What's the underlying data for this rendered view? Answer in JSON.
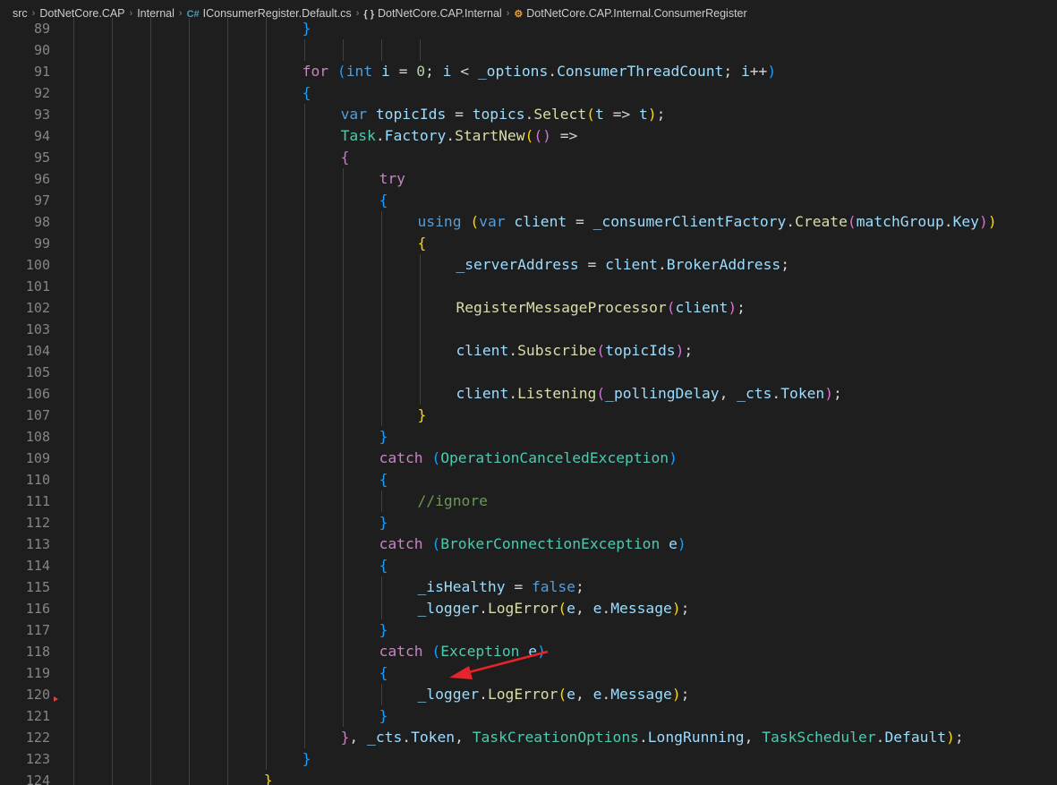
{
  "breadcrumb": {
    "items": [
      {
        "label": "src",
        "icon": ""
      },
      {
        "label": "DotNetCore.CAP",
        "icon": ""
      },
      {
        "label": "Internal",
        "icon": ""
      },
      {
        "label": "IConsumerRegister.Default.cs",
        "icon": "csharp-file-icon"
      },
      {
        "label": "DotNetCore.CAP.Internal",
        "icon": "namespace-icon"
      },
      {
        "label": "DotNetCore.CAP.Internal.ConsumerRegister",
        "icon": "class-icon"
      }
    ],
    "icons": {
      "csharp": "C#",
      "namespace": "{ }",
      "class": "⚙"
    }
  },
  "code": {
    "lines": [
      {
        "n": "89",
        "indent": 6,
        "tokens": [
          {
            "t": "}",
            "c": "b3"
          }
        ]
      },
      {
        "n": "90",
        "indent": 0,
        "tokens": []
      },
      {
        "n": "91",
        "indent": 6,
        "tokens": [
          {
            "t": "for",
            "c": "ctl"
          },
          {
            "t": " "
          },
          {
            "t": "(",
            "c": "b3"
          },
          {
            "t": "int",
            "c": "kw"
          },
          {
            "t": " "
          },
          {
            "t": "i",
            "c": "vr"
          },
          {
            "t": " = "
          },
          {
            "t": "0",
            "c": "num"
          },
          {
            "t": "; "
          },
          {
            "t": "i",
            "c": "vr"
          },
          {
            "t": " < "
          },
          {
            "t": "_options",
            "c": "vr"
          },
          {
            "t": "."
          },
          {
            "t": "ConsumerThreadCount",
            "c": "vr"
          },
          {
            "t": "; "
          },
          {
            "t": "i",
            "c": "vr"
          },
          {
            "t": "++"
          },
          {
            "t": ")",
            "c": "b3"
          }
        ]
      },
      {
        "n": "92",
        "indent": 6,
        "tokens": [
          {
            "t": "{",
            "c": "b3"
          }
        ]
      },
      {
        "n": "93",
        "indent": 7,
        "tokens": [
          {
            "t": "var",
            "c": "kw"
          },
          {
            "t": " "
          },
          {
            "t": "topicIds",
            "c": "vr"
          },
          {
            "t": " = "
          },
          {
            "t": "topics",
            "c": "vr"
          },
          {
            "t": "."
          },
          {
            "t": "Select",
            "c": "fn"
          },
          {
            "t": "(",
            "c": "b1"
          },
          {
            "t": "t",
            "c": "vr"
          },
          {
            "t": " => "
          },
          {
            "t": "t",
            "c": "vr"
          },
          {
            "t": ")",
            "c": "b1"
          },
          {
            "t": ";"
          }
        ]
      },
      {
        "n": "94",
        "indent": 7,
        "tokens": [
          {
            "t": "Task",
            "c": "ty"
          },
          {
            "t": "."
          },
          {
            "t": "Factory",
            "c": "vr"
          },
          {
            "t": "."
          },
          {
            "t": "StartNew",
            "c": "fn"
          },
          {
            "t": "(",
            "c": "b1"
          },
          {
            "t": "()",
            "c": "b2"
          },
          {
            "t": " =>"
          }
        ]
      },
      {
        "n": "95",
        "indent": 7,
        "tokens": [
          {
            "t": "{",
            "c": "b2"
          }
        ]
      },
      {
        "n": "96",
        "indent": 8,
        "tokens": [
          {
            "t": "try",
            "c": "ctl"
          }
        ]
      },
      {
        "n": "97",
        "indent": 8,
        "tokens": [
          {
            "t": "{",
            "c": "b3"
          }
        ]
      },
      {
        "n": "98",
        "indent": 9,
        "tokens": [
          {
            "t": "using",
            "c": "kw"
          },
          {
            "t": " "
          },
          {
            "t": "(",
            "c": "b1"
          },
          {
            "t": "var",
            "c": "kw"
          },
          {
            "t": " "
          },
          {
            "t": "client",
            "c": "vr"
          },
          {
            "t": " = "
          },
          {
            "t": "_consumerClientFactory",
            "c": "vr"
          },
          {
            "t": "."
          },
          {
            "t": "Create",
            "c": "fn"
          },
          {
            "t": "(",
            "c": "b2"
          },
          {
            "t": "matchGroup",
            "c": "vr"
          },
          {
            "t": "."
          },
          {
            "t": "Key",
            "c": "vr"
          },
          {
            "t": ")",
            "c": "b2"
          },
          {
            "t": ")",
            "c": "b1"
          }
        ]
      },
      {
        "n": "99",
        "indent": 9,
        "tokens": [
          {
            "t": "{",
            "c": "b1"
          }
        ]
      },
      {
        "n": "100",
        "indent": 10,
        "tokens": [
          {
            "t": "_serverAddress",
            "c": "vr"
          },
          {
            "t": " = "
          },
          {
            "t": "client",
            "c": "vr"
          },
          {
            "t": "."
          },
          {
            "t": "BrokerAddress",
            "c": "vr"
          },
          {
            "t": ";"
          }
        ]
      },
      {
        "n": "101",
        "indent": 0,
        "tokens": []
      },
      {
        "n": "102",
        "indent": 10,
        "tokens": [
          {
            "t": "RegisterMessageProcessor",
            "c": "fn"
          },
          {
            "t": "(",
            "c": "b2"
          },
          {
            "t": "client",
            "c": "vr"
          },
          {
            "t": ")",
            "c": "b2"
          },
          {
            "t": ";"
          }
        ]
      },
      {
        "n": "103",
        "indent": 0,
        "tokens": []
      },
      {
        "n": "104",
        "indent": 10,
        "tokens": [
          {
            "t": "client",
            "c": "vr"
          },
          {
            "t": "."
          },
          {
            "t": "Subscribe",
            "c": "fn"
          },
          {
            "t": "(",
            "c": "b2"
          },
          {
            "t": "topicIds",
            "c": "vr"
          },
          {
            "t": ")",
            "c": "b2"
          },
          {
            "t": ";"
          }
        ]
      },
      {
        "n": "105",
        "indent": 0,
        "tokens": []
      },
      {
        "n": "106",
        "indent": 10,
        "tokens": [
          {
            "t": "client",
            "c": "vr"
          },
          {
            "t": "."
          },
          {
            "t": "Listening",
            "c": "fn"
          },
          {
            "t": "(",
            "c": "b2"
          },
          {
            "t": "_pollingDelay",
            "c": "vr"
          },
          {
            "t": ", "
          },
          {
            "t": "_cts",
            "c": "vr"
          },
          {
            "t": "."
          },
          {
            "t": "Token",
            "c": "vr"
          },
          {
            "t": ")",
            "c": "b2"
          },
          {
            "t": ";"
          }
        ]
      },
      {
        "n": "107",
        "indent": 9,
        "tokens": [
          {
            "t": "}",
            "c": "b1"
          }
        ]
      },
      {
        "n": "108",
        "indent": 8,
        "tokens": [
          {
            "t": "}",
            "c": "b3"
          }
        ]
      },
      {
        "n": "109",
        "indent": 8,
        "tokens": [
          {
            "t": "catch",
            "c": "ctl"
          },
          {
            "t": " "
          },
          {
            "t": "(",
            "c": "b3"
          },
          {
            "t": "OperationCanceledException",
            "c": "ty"
          },
          {
            "t": ")",
            "c": "b3"
          }
        ]
      },
      {
        "n": "110",
        "indent": 8,
        "tokens": [
          {
            "t": "{",
            "c": "b3"
          }
        ]
      },
      {
        "n": "111",
        "indent": 9,
        "tokens": [
          {
            "t": "//ignore",
            "c": "cm"
          }
        ]
      },
      {
        "n": "112",
        "indent": 8,
        "tokens": [
          {
            "t": "}",
            "c": "b3"
          }
        ]
      },
      {
        "n": "113",
        "indent": 8,
        "tokens": [
          {
            "t": "catch",
            "c": "ctl"
          },
          {
            "t": " "
          },
          {
            "t": "(",
            "c": "b3"
          },
          {
            "t": "BrokerConnectionException",
            "c": "ty"
          },
          {
            "t": " "
          },
          {
            "t": "e",
            "c": "vr"
          },
          {
            "t": ")",
            "c": "b3"
          }
        ]
      },
      {
        "n": "114",
        "indent": 8,
        "tokens": [
          {
            "t": "{",
            "c": "b3"
          }
        ]
      },
      {
        "n": "115",
        "indent": 9,
        "tokens": [
          {
            "t": "_isHealthy",
            "c": "vr"
          },
          {
            "t": " = "
          },
          {
            "t": "false",
            "c": "kw"
          },
          {
            "t": ";"
          }
        ]
      },
      {
        "n": "116",
        "indent": 9,
        "tokens": [
          {
            "t": "_logger",
            "c": "vr"
          },
          {
            "t": "."
          },
          {
            "t": "LogError",
            "c": "fn"
          },
          {
            "t": "(",
            "c": "b1"
          },
          {
            "t": "e",
            "c": "vr"
          },
          {
            "t": ", "
          },
          {
            "t": "e",
            "c": "vr"
          },
          {
            "t": "."
          },
          {
            "t": "Message",
            "c": "vr"
          },
          {
            "t": ")",
            "c": "b1"
          },
          {
            "t": ";"
          }
        ]
      },
      {
        "n": "117",
        "indent": 8,
        "tokens": [
          {
            "t": "}",
            "c": "b3"
          }
        ]
      },
      {
        "n": "118",
        "indent": 8,
        "tokens": [
          {
            "t": "catch",
            "c": "ctl"
          },
          {
            "t": " "
          },
          {
            "t": "(",
            "c": "b3"
          },
          {
            "t": "Exception",
            "c": "ty"
          },
          {
            "t": " "
          },
          {
            "t": "e",
            "c": "vr"
          },
          {
            "t": ")",
            "c": "b3"
          }
        ]
      },
      {
        "n": "119",
        "indent": 8,
        "tokens": [
          {
            "t": "{",
            "c": "b3"
          }
        ]
      },
      {
        "n": "120",
        "indent": 9,
        "tokens": [
          {
            "t": "_logger",
            "c": "vr"
          },
          {
            "t": "."
          },
          {
            "t": "LogError",
            "c": "fn"
          },
          {
            "t": "(",
            "c": "b1"
          },
          {
            "t": "e",
            "c": "vr"
          },
          {
            "t": ", "
          },
          {
            "t": "e",
            "c": "vr"
          },
          {
            "t": "."
          },
          {
            "t": "Message",
            "c": "vr"
          },
          {
            "t": ")",
            "c": "b1"
          },
          {
            "t": ";"
          }
        ]
      },
      {
        "n": "121",
        "indent": 8,
        "tokens": [
          {
            "t": "}",
            "c": "b3"
          }
        ]
      },
      {
        "n": "122",
        "indent": 7,
        "tokens": [
          {
            "t": "}",
            "c": "b2"
          },
          {
            "t": ", "
          },
          {
            "t": "_cts",
            "c": "vr"
          },
          {
            "t": "."
          },
          {
            "t": "Token",
            "c": "vr"
          },
          {
            "t": ", "
          },
          {
            "t": "TaskCreationOptions",
            "c": "ty"
          },
          {
            "t": "."
          },
          {
            "t": "LongRunning",
            "c": "vr"
          },
          {
            "t": ", "
          },
          {
            "t": "TaskScheduler",
            "c": "ty"
          },
          {
            "t": "."
          },
          {
            "t": "Default",
            "c": "vr"
          },
          {
            "t": ")",
            "c": "b1"
          },
          {
            "t": ";"
          }
        ]
      },
      {
        "n": "123",
        "indent": 6,
        "tokens": [
          {
            "t": "}",
            "c": "b3"
          }
        ]
      },
      {
        "n": "124",
        "indent": 5,
        "tokens": [
          {
            "t": "}",
            "c": "b1"
          }
        ]
      }
    ]
  },
  "annotation": {
    "arrow_color": "#e8242a"
  }
}
